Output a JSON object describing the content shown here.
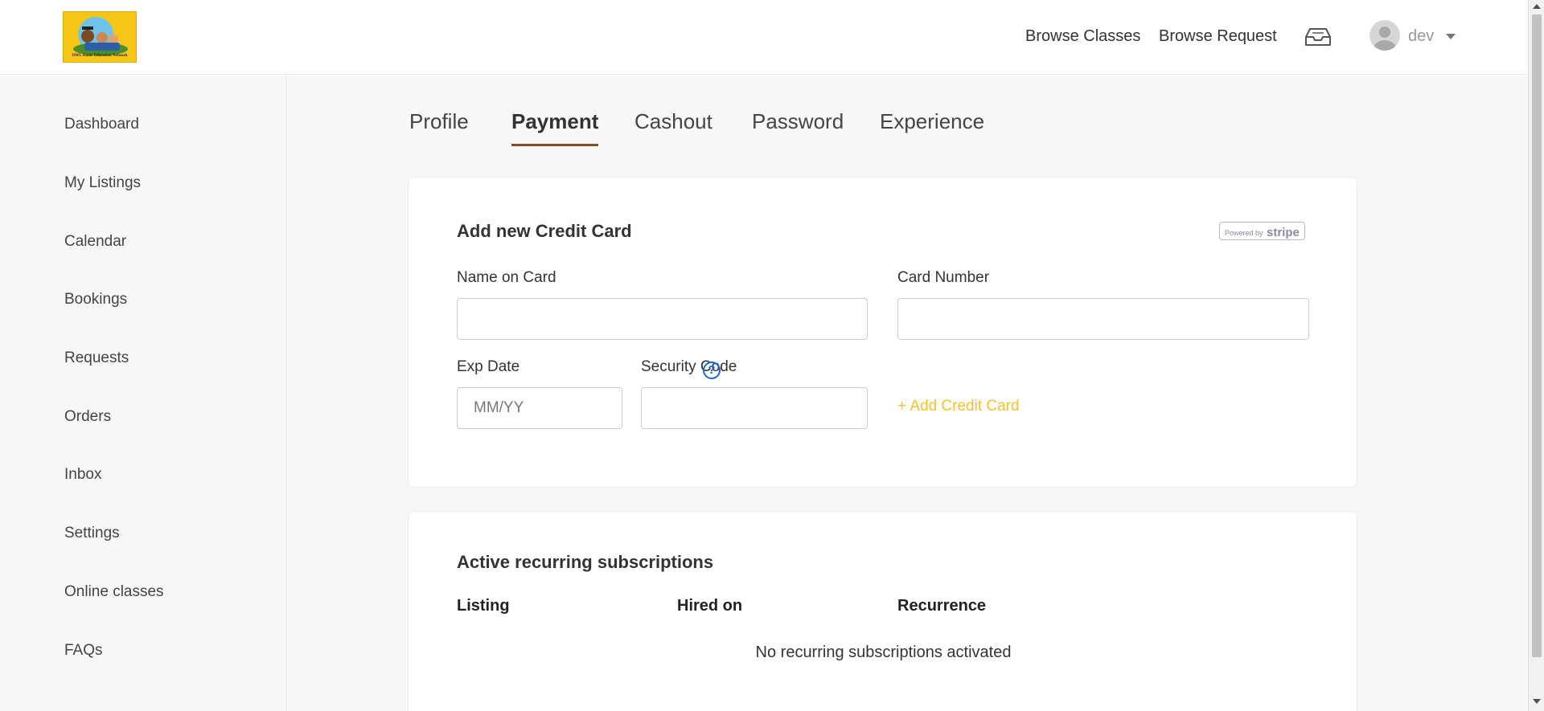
{
  "header": {
    "logo_text": "OWL Home Education Network",
    "nav": [
      {
        "label": "Browse Classes"
      },
      {
        "label": "Browse Request"
      }
    ],
    "user_name": "dev",
    "icons": {
      "inbox": "inbox-tray-icon",
      "avatar": "user-avatar-icon",
      "caret": "chevron-down-icon"
    }
  },
  "sidebar": {
    "items": [
      {
        "label": "Dashboard"
      },
      {
        "label": "My Listings"
      },
      {
        "label": "Calendar"
      },
      {
        "label": "Bookings"
      },
      {
        "label": "Requests"
      },
      {
        "label": "Orders"
      },
      {
        "label": "Inbox"
      },
      {
        "label": "Settings"
      },
      {
        "label": "Online classes"
      },
      {
        "label": "FAQs"
      }
    ]
  },
  "tabs": [
    {
      "label": "Profile",
      "active": false
    },
    {
      "label": "Payment",
      "active": true
    },
    {
      "label": "Cashout",
      "active": false
    },
    {
      "label": "Password",
      "active": false
    },
    {
      "label": "Experience",
      "active": false
    }
  ],
  "credit_card_form": {
    "title": "Add new Credit Card",
    "stripe_prefix": "Powered by",
    "stripe_brand": "stripe",
    "name_label": "Name on Card",
    "name_value": "",
    "number_label": "Card Number",
    "number_value": "",
    "exp_label": "Exp Date",
    "exp_placeholder": "MM/YY",
    "security_label": "Security Code",
    "security_value": "",
    "help_glyph": "?",
    "add_button_label": "+ Add Credit Card"
  },
  "subscriptions": {
    "title": "Active recurring subscriptions",
    "columns": [
      {
        "label": "Listing"
      },
      {
        "label": "Hired on"
      },
      {
        "label": "Recurrence"
      }
    ],
    "empty_message": "No recurring subscriptions activated"
  },
  "colors": {
    "accent_tab_underline": "#8a4a22",
    "add_card_link": "#f2c230",
    "help_icon": "#1a6ad1",
    "logo_background": "#f5c518"
  }
}
